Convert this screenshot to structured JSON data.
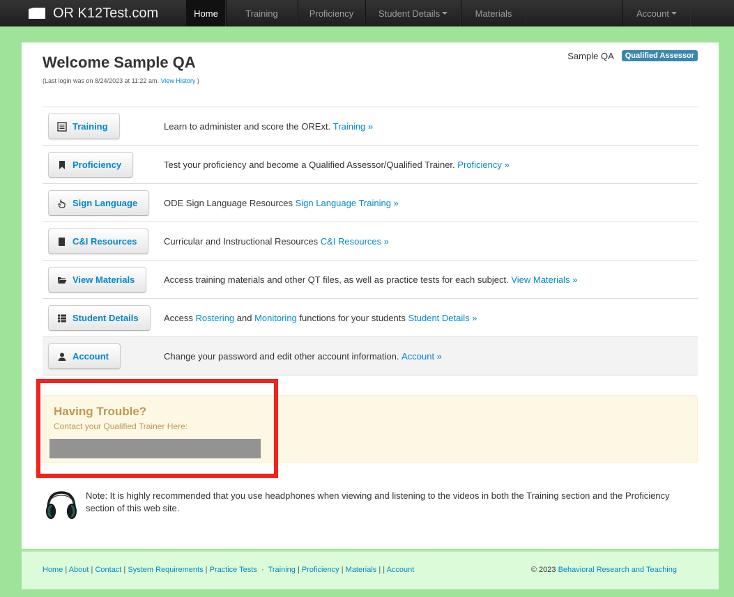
{
  "app": {
    "brand": "OR K12Test.com"
  },
  "nav": {
    "home": "Home",
    "training": "Training",
    "proficiency": "Proficiency",
    "student_details": "Student Details",
    "materials": "Materials",
    "account": "Account"
  },
  "header": {
    "title": "Welcome Sample QA",
    "last_login_prefix": "(Last login was on 8/24/2023 at 11:22 am.",
    "view_history": "View History",
    "last_login_suffix": ")",
    "user_name": "Sample QA",
    "role_badge": "Qualified Assessor"
  },
  "rows": [
    {
      "button": "Training",
      "icon": "list-icon",
      "text": "Learn to administer and score the ORExt. ",
      "link": "Training »"
    },
    {
      "button": "Proficiency",
      "icon": "bookmark-icon",
      "text": "Test your proficiency and become a Qualified Assessor/Qualified Trainer. ",
      "link": "Proficiency »"
    },
    {
      "button": "Sign Language",
      "icon": "hand-icon",
      "text": "ODE Sign Language Resources ",
      "link": "Sign Language Training »"
    },
    {
      "button": "C&I Resources",
      "icon": "book-icon",
      "text": "Curricular and Instructional Resources ",
      "link": "C&I Resources »"
    },
    {
      "button": "View Materials",
      "icon": "folder-icon",
      "text": "Access training materials and other QT files, as well as practice tests for each subject. ",
      "link": "View Materials »"
    },
    {
      "button": "Student Details",
      "icon": "th-list-icon",
      "text_a": "Access ",
      "link_a": "Rostering",
      "text_b": " and ",
      "link_b": "Monitoring",
      "text_c": " functions for your students ",
      "link": "Student Details »"
    },
    {
      "button": "Account",
      "icon": "user-icon",
      "text": "Change your password and edit other account information. ",
      "link": "Account »"
    }
  ],
  "trouble": {
    "heading": "Having Trouble?",
    "subtext": "Contact your Qualified Trainer Here:"
  },
  "note": {
    "text": "Note: It is highly recommended that you use headphones when viewing and listening to the videos in both the Training section and the Proficiency section of this web site."
  },
  "footer": {
    "home": "Home",
    "about": "About",
    "contact": "Contact",
    "system_requirements": "System Requirements",
    "practice_tests": "Practice Tests",
    "training": "Training",
    "proficiency": "Proficiency",
    "materials": "Materials",
    "account": "Account",
    "copyright_prefix": "© 2023 ",
    "copyright_link": "Behavioral Research and Teaching"
  },
  "colors": {
    "accent": "#0088cc",
    "badge": "#3a87ad",
    "warning_text": "#c09853",
    "page_bg": "#9fe39a",
    "highlight_box": "#f4221b"
  }
}
